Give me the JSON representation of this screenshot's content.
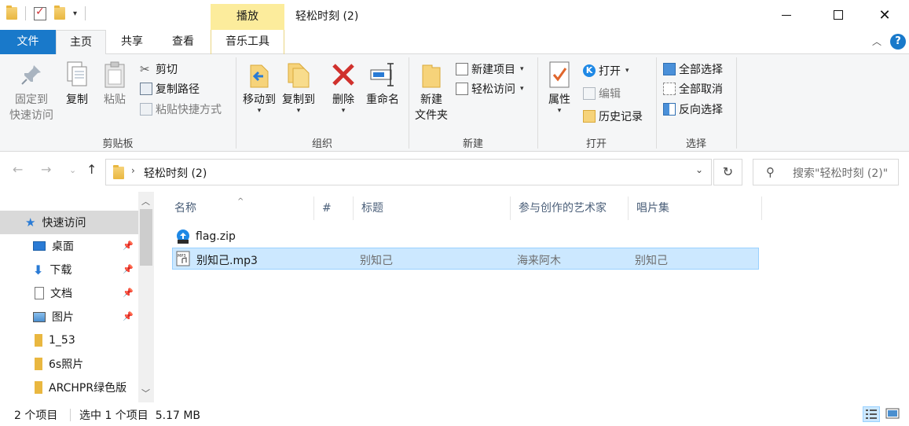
{
  "window": {
    "title": "轻松时刻 (2)",
    "context_tab_group": "播放"
  },
  "ribbon_tabs": {
    "file": "文件",
    "home": "主页",
    "share": "共享",
    "view": "查看",
    "music_tools": "音乐工具"
  },
  "ribbon": {
    "clipboard": {
      "label": "剪贴板",
      "pin_line1": "固定到",
      "pin_line2": "快速访问",
      "copy": "复制",
      "paste": "粘贴",
      "cut": "剪切",
      "copy_path": "复制路径",
      "paste_shortcut": "粘贴快捷方式"
    },
    "organize": {
      "label": "组织",
      "move_to": "移动到",
      "copy_to": "复制到",
      "delete": "删除",
      "rename": "重命名"
    },
    "new": {
      "label": "新建",
      "new_folder_line1": "新建",
      "new_folder_line2": "文件夹",
      "new_item": "新建项目",
      "easy_access": "轻松访问"
    },
    "open": {
      "label": "打开",
      "properties": "属性",
      "open": "打开",
      "edit": "编辑",
      "history": "历史记录"
    },
    "select": {
      "label": "选择",
      "select_all": "全部选择",
      "select_none": "全部取消",
      "invert": "反向选择"
    }
  },
  "address": {
    "path": "轻松时刻 (2)",
    "search_placeholder": "搜索\"轻松时刻 (2)\""
  },
  "nav_pane": {
    "items": [
      {
        "label": "快速访问",
        "icon": "star-icon",
        "pinned": false
      },
      {
        "label": "桌面",
        "icon": "desktop-icon",
        "pinned": true
      },
      {
        "label": "下载",
        "icon": "download-icon",
        "pinned": true
      },
      {
        "label": "文档",
        "icon": "document-icon",
        "pinned": true
      },
      {
        "label": "图片",
        "icon": "picture-icon",
        "pinned": true
      },
      {
        "label": "1_53",
        "icon": "folder-icon",
        "pinned": false
      },
      {
        "label": "6s照片",
        "icon": "folder-icon",
        "pinned": false
      },
      {
        "label": "ARCHPR绿色版",
        "icon": "folder-icon",
        "pinned": false
      }
    ]
  },
  "file_list": {
    "columns": [
      "名称",
      "#",
      "标题",
      "参与创作的艺术家",
      "唱片集"
    ],
    "rows": [
      {
        "name": "flag.zip",
        "number": "",
        "title": "",
        "artist": "",
        "album": "",
        "icon": "zip-file-icon",
        "selected": false
      },
      {
        "name": "别知己.mp3",
        "number": "",
        "title": "别知己",
        "artist": "海来阿木",
        "album": "别知己",
        "icon": "mp3-file-icon",
        "selected": true
      }
    ]
  },
  "status": {
    "item_count": "2 个项目",
    "selection": "选中 1 个项目  5.17 MB"
  },
  "colors": {
    "file_tab": "#1979ca",
    "context_tab": "#fcec9c",
    "selection": "#cce8ff",
    "folder": "#e9b740"
  }
}
